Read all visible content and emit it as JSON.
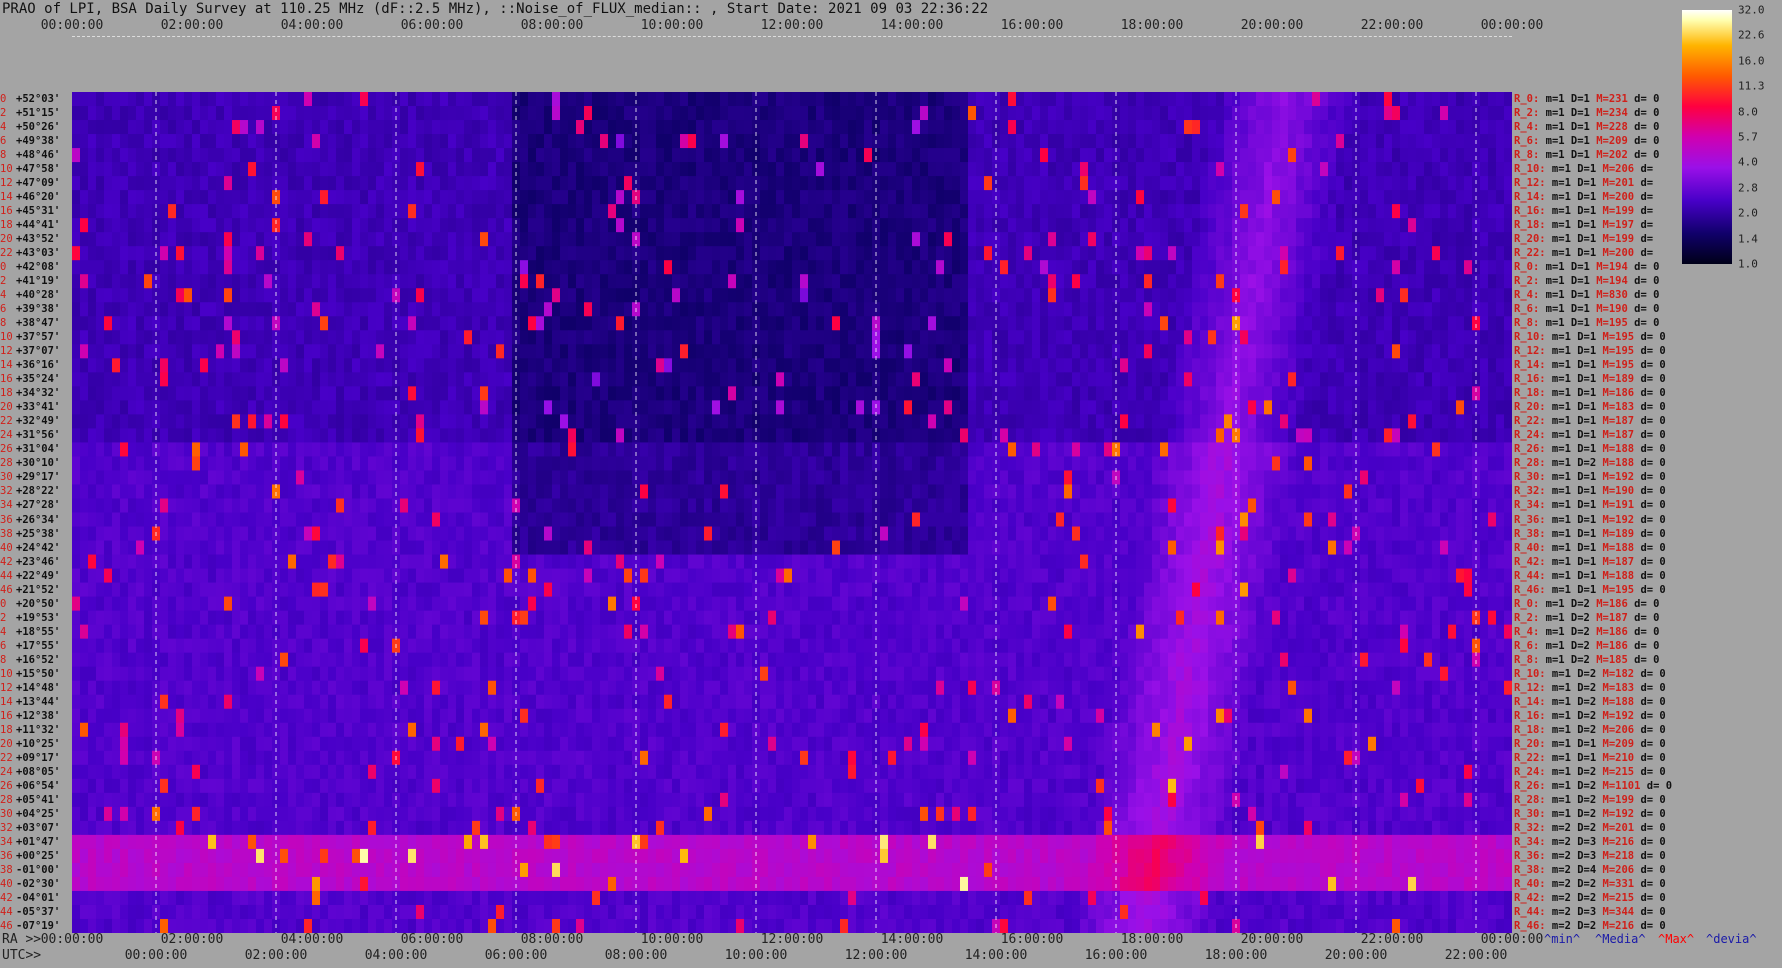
{
  "title": "PRAO of LPI, BSA Daily Survey at 110.25 MHz (dF::2.5 MHz), ::Noise_of_FLUX_median:: , Start Date: 2021 09 03 22:36:22",
  "top_ticks": [
    "00:00:00",
    "02:00:00",
    "04:00:00",
    "06:00:00",
    "08:00:00",
    "10:00:00",
    "12:00:00",
    "14:00:00",
    "16:00:00",
    "18:00:00",
    "20:00:00",
    "22:00:00",
    "00:00:00"
  ],
  "ra_ticks": [
    "00:00:00",
    "02:00:00",
    "04:00:00",
    "06:00:00",
    "08:00:00",
    "10:00:00",
    "12:00:00",
    "14:00:00",
    "16:00:00",
    "18:00:00",
    "20:00:00",
    "22:00:00",
    "00:00:00"
  ],
  "utc_ticks": [
    "00:00:00",
    "02:00:00",
    "04:00:00",
    "06:00:00",
    "08:00:00",
    "10:00:00",
    "12:00:00",
    "14:00:00",
    "16:00:00",
    "18:00:00",
    "20:00:00",
    "22:00:00"
  ],
  "ra_label": "RA >>",
  "utc_label": "UTC>>",
  "legend": {
    "min": "^min^",
    "median": "^Media^",
    "max": "^Max^",
    "devia": "^devia^"
  },
  "colors": {
    "background": "#a4a4a4",
    "index": "#d0201a",
    "max": "#ff0000"
  },
  "chart_data": {
    "type": "heatmap",
    "title": "PRAO of LPI, BSA Daily Survey at 110.25 MHz (dF::2.5 MHz), ::Noise_of_FLUX_median:: , Start Date: 2021 09 03 22:36:22",
    "colorbar_ticks": [
      "32.0",
      "22.6",
      "16.0",
      "11.3",
      "8.0",
      "5.7",
      "4.0",
      "2.8",
      "2.0",
      "1.4",
      "1.0"
    ],
    "colorbar_range": [
      1.0,
      32.0
    ],
    "colorbar_scale": "log",
    "declinations": [
      "+52°03'",
      "+51°15'",
      "+50°26'",
      "+49°38'",
      "+48°46'",
      "+47°58'",
      "+47°09'",
      "+46°20'",
      "+45°31'",
      "+44°41'",
      "+43°52'",
      "+43°03'",
      "+42°08'",
      "+41°19'",
      "+40°28'",
      "+39°38'",
      "+38°47'",
      "+37°57'",
      "+37°07'",
      "+36°16'",
      "+35°24'",
      "+34°32'",
      "+33°41'",
      "+32°49'",
      "+31°56'",
      "+31°04'",
      "+30°10'",
      "+29°17'",
      "+28°22'",
      "+27°28'",
      "+26°34'",
      "+25°38'",
      "+24°42'",
      "+23°46'",
      "+22°49'",
      "+21°52'",
      "+20°50'",
      "+19°53'",
      "+18°55'",
      "+17°55'",
      "+16°52'",
      "+15°50'",
      "+14°48'",
      "+13°44'",
      "+12°38'",
      "+11°32'",
      "+10°25'",
      "+09°17'",
      "+08°05'",
      "+06°54'",
      "+05°41'",
      "+04°25'",
      "+03°07'",
      "+01°47'",
      "+00°25'",
      "-01°00'",
      "-02°30'",
      "-04°01'",
      "-05°37'",
      "-07°19'"
    ],
    "row_indices": [
      "0",
      "2",
      "4",
      "6",
      "8",
      "10",
      "12",
      "14",
      "16",
      "18",
      "20",
      "22",
      "0",
      "2",
      "4",
      "6",
      "8",
      "10",
      "12",
      "14",
      "16",
      "18",
      "20",
      "22",
      "24",
      "26",
      "28",
      "30",
      "32",
      "34",
      "36",
      "38",
      "40",
      "42",
      "44",
      "46",
      "0",
      "2",
      "4",
      "6",
      "8",
      "10",
      "12",
      "14",
      "16",
      "18",
      "20",
      "22",
      "24",
      "26",
      "28",
      "30",
      "32",
      "34",
      "36",
      "38",
      "40",
      "42",
      "44",
      "46"
    ],
    "beam_stats": [
      {
        "r": "R_0:",
        "m": "m=1",
        "D": "D=1",
        "M": "M=231",
        "d": "d= 0"
      },
      {
        "r": "R_2:",
        "m": "m=1",
        "D": "D=1",
        "M": "M=234",
        "d": "d= 0"
      },
      {
        "r": "R_4:",
        "m": "m=1",
        "D": "D=1",
        "M": "M=228",
        "d": "d= 0"
      },
      {
        "r": "R_6:",
        "m": "m=1",
        "D": "D=1",
        "M": "M=209",
        "d": "d= 0"
      },
      {
        "r": "R_8:",
        "m": "m=1",
        "D": "D=1",
        "M": "M=202",
        "d": "d= 0"
      },
      {
        "r": "R_10:",
        "m": "m=1",
        "D": "D=1",
        "M": "M=206",
        "d": "d="
      },
      {
        "r": "R_12:",
        "m": "m=1",
        "D": "D=1",
        "M": "M=201",
        "d": "d="
      },
      {
        "r": "R_14:",
        "m": "m=1",
        "D": "D=1",
        "M": "M=200",
        "d": "d="
      },
      {
        "r": "R_16:",
        "m": "m=1",
        "D": "D=1",
        "M": "M=199",
        "d": "d="
      },
      {
        "r": "R_18:",
        "m": "m=1",
        "D": "D=1",
        "M": "M=197",
        "d": "d="
      },
      {
        "r": "R_20:",
        "m": "m=1",
        "D": "D=1",
        "M": "M=199",
        "d": "d="
      },
      {
        "r": "R_22:",
        "m": "m=1",
        "D": "D=1",
        "M": "M=200",
        "d": "d="
      },
      {
        "r": "R_0:",
        "m": "m=1",
        "D": "D=1",
        "M": "M=194",
        "d": "d= 0"
      },
      {
        "r": "R_2:",
        "m": "m=1",
        "D": "D=1",
        "M": "M=194",
        "d": "d= 0"
      },
      {
        "r": "R_4:",
        "m": "m=1",
        "D": "D=1",
        "M": "M=830",
        "d": "d= 0"
      },
      {
        "r": "R_6:",
        "m": "m=1",
        "D": "D=1",
        "M": "M=190",
        "d": "d= 0"
      },
      {
        "r": "R_8:",
        "m": "m=1",
        "D": "D=1",
        "M": "M=195",
        "d": "d= 0"
      },
      {
        "r": "R_10:",
        "m": "m=1",
        "D": "D=1",
        "M": "M=195",
        "d": "d= 0"
      },
      {
        "r": "R_12:",
        "m": "m=1",
        "D": "D=1",
        "M": "M=195",
        "d": "d= 0"
      },
      {
        "r": "R_14:",
        "m": "m=1",
        "D": "D=1",
        "M": "M=195",
        "d": "d= 0"
      },
      {
        "r": "R_16:",
        "m": "m=1",
        "D": "D=1",
        "M": "M=189",
        "d": "d= 0"
      },
      {
        "r": "R_18:",
        "m": "m=1",
        "D": "D=1",
        "M": "M=186",
        "d": "d= 0"
      },
      {
        "r": "R_20:",
        "m": "m=1",
        "D": "D=1",
        "M": "M=183",
        "d": "d= 0"
      },
      {
        "r": "R_22:",
        "m": "m=1",
        "D": "D=1",
        "M": "M=187",
        "d": "d= 0"
      },
      {
        "r": "R_24:",
        "m": "m=1",
        "D": "D=1",
        "M": "M=187",
        "d": "d= 0"
      },
      {
        "r": "R_26:",
        "m": "m=1",
        "D": "D=1",
        "M": "M=188",
        "d": "d= 0"
      },
      {
        "r": "R_28:",
        "m": "m=1",
        "D": "D=2",
        "M": "M=188",
        "d": "d= 0"
      },
      {
        "r": "R_30:",
        "m": "m=1",
        "D": "D=1",
        "M": "M=192",
        "d": "d= 0"
      },
      {
        "r": "R_32:",
        "m": "m=1",
        "D": "D=1",
        "M": "M=190",
        "d": "d= 0"
      },
      {
        "r": "R_34:",
        "m": "m=1",
        "D": "D=1",
        "M": "M=191",
        "d": "d= 0"
      },
      {
        "r": "R_36:",
        "m": "m=1",
        "D": "D=1",
        "M": "M=192",
        "d": "d= 0"
      },
      {
        "r": "R_38:",
        "m": "m=1",
        "D": "D=1",
        "M": "M=189",
        "d": "d= 0"
      },
      {
        "r": "R_40:",
        "m": "m=1",
        "D": "D=1",
        "M": "M=188",
        "d": "d= 0"
      },
      {
        "r": "R_42:",
        "m": "m=1",
        "D": "D=1",
        "M": "M=187",
        "d": "d= 0"
      },
      {
        "r": "R_44:",
        "m": "m=1",
        "D": "D=1",
        "M": "M=188",
        "d": "d= 0"
      },
      {
        "r": "R_46:",
        "m": "m=1",
        "D": "D=1",
        "M": "M=195",
        "d": "d= 0"
      },
      {
        "r": "R_0:",
        "m": "m=1",
        "D": "D=2",
        "M": "M=186",
        "d": "d= 0"
      },
      {
        "r": "R_2:",
        "m": "m=1",
        "D": "D=2",
        "M": "M=187",
        "d": "d= 0"
      },
      {
        "r": "R_4:",
        "m": "m=1",
        "D": "D=2",
        "M": "M=186",
        "d": "d= 0"
      },
      {
        "r": "R_6:",
        "m": "m=1",
        "D": "D=2",
        "M": "M=186",
        "d": "d= 0"
      },
      {
        "r": "R_8:",
        "m": "m=1",
        "D": "D=2",
        "M": "M=185",
        "d": "d= 0"
      },
      {
        "r": "R_10:",
        "m": "m=1",
        "D": "D=2",
        "M": "M=182",
        "d": "d= 0"
      },
      {
        "r": "R_12:",
        "m": "m=1",
        "D": "D=2",
        "M": "M=183",
        "d": "d= 0"
      },
      {
        "r": "R_14:",
        "m": "m=1",
        "D": "D=2",
        "M": "M=188",
        "d": "d= 0"
      },
      {
        "r": "R_16:",
        "m": "m=1",
        "D": "D=2",
        "M": "M=192",
        "d": "d= 0"
      },
      {
        "r": "R_18:",
        "m": "m=1",
        "D": "D=2",
        "M": "M=206",
        "d": "d= 0"
      },
      {
        "r": "R_20:",
        "m": "m=1",
        "D": "D=1",
        "M": "M=209",
        "d": "d= 0"
      },
      {
        "r": "R_22:",
        "m": "m=1",
        "D": "D=1",
        "M": "M=210",
        "d": "d= 0"
      },
      {
        "r": "R_24:",
        "m": "m=1",
        "D": "D=2",
        "M": "M=215",
        "d": "d= 0"
      },
      {
        "r": "R_26:",
        "m": "m=1",
        "D": "D=2",
        "M": "M=1101",
        "d": "d= 0"
      },
      {
        "r": "R_28:",
        "m": "m=1",
        "D": "D=2",
        "M": "M=199",
        "d": "d= 0"
      },
      {
        "r": "R_30:",
        "m": "m=1",
        "D": "D=2",
        "M": "M=192",
        "d": "d= 0"
      },
      {
        "r": "R_32:",
        "m": "m=2",
        "D": "D=2",
        "M": "M=201",
        "d": "d= 0"
      },
      {
        "r": "R_34:",
        "m": "m=2",
        "D": "D=3",
        "M": "M=216",
        "d": "d= 0"
      },
      {
        "r": "R_36:",
        "m": "m=2",
        "D": "D=3",
        "M": "M=218",
        "d": "d= 0"
      },
      {
        "r": "R_38:",
        "m": "m=2",
        "D": "D=4",
        "M": "M=206",
        "d": "d= 0"
      },
      {
        "r": "R_40:",
        "m": "m=2",
        "D": "D=2",
        "M": "M=331",
        "d": "d= 0"
      },
      {
        "r": "R_42:",
        "m": "m=2",
        "D": "D=2",
        "M": "M=215",
        "d": "d= 0"
      },
      {
        "r": "R_44:",
        "m": "m=2",
        "D": "D=3",
        "M": "M=344",
        "d": "d= 0"
      },
      {
        "r": "R_46:",
        "m": "m=2",
        "D": "D=2",
        "M": "M=216",
        "d": "d= 0"
      }
    ]
  }
}
